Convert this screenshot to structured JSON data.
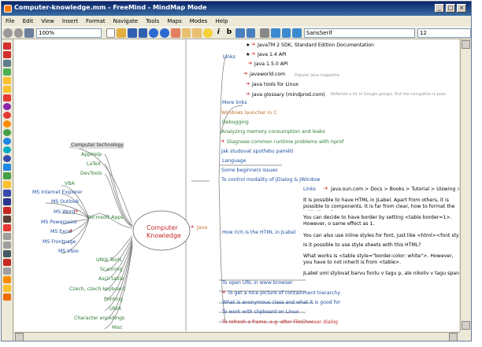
{
  "window": {
    "title": "Computer-knowledge.mm - FreeMind - MindMap Mode"
  },
  "menu": [
    "File",
    "Edit",
    "View",
    "Insert",
    "Format",
    "Navigate",
    "Tools",
    "Maps",
    "Modes",
    "Help"
  ],
  "toolbar": {
    "zoom": "100%",
    "font": "SansSerif",
    "size": "12"
  },
  "root": "Computer Knowledge",
  "left": {
    "computer_technology": "Computer technology",
    "apphelp": "AppHelp",
    "latex": "LaTeX",
    "devtools": "DevTools",
    "vba": "VBA",
    "ms_ie": "MS Internet Explorer",
    "ms_outlook": "MS Outlook",
    "ms_word": "MS Word",
    "ms_powerpoint": "MS Powerpoint",
    "ms_excel": "MS Excel",
    "ms_frontpage": "MS Frontpage",
    "ms_visio": "MS Visio",
    "microsoft_apps": "Microsoft Apps",
    "unix_tools": "UNIX Tools",
    "scanning": "Scanning",
    "ascii_table": "Ascii table",
    "czech_keyboard": "Czech, czech keyboard",
    "printing": "Printing",
    "unix": "UNIX",
    "character_encodings": "Character encodings",
    "misc": "Misc"
  },
  "java": "Java",
  "links": "Links",
  "java_links": [
    {
      "text": "JavaTM 2 SDK, Standard Edition  Documentation",
      "note": ""
    },
    {
      "text": "Java 1.4 API",
      "note": ""
    },
    {
      "text": "Java 1.5.0 API",
      "note": ""
    },
    {
      "text": "javaworld.com",
      "note": "Popular Java magazine"
    },
    {
      "text": "Java tools for Linux",
      "note": ""
    },
    {
      "text": "Java glossary  (mindprod.com)",
      "note": "Referred a lot in Google groups. But the navigation is poor."
    }
  ],
  "java_items_top": [
    "More links",
    "Windows launcher in C",
    "Debugging",
    "Analyzing memory consumption and leaks",
    "Diagnose common runtime problems with hprof",
    "Jak studovat spotřebu paměti",
    "Language",
    "Some beginners issues",
    "To control modality of JDialog & JWindow"
  ],
  "html_label": {
    "title": "How rich is the HTML in JLabel",
    "links": "Links",
    "breadcrumb": "java.sun.com > Docs > Books > Tutorial > Uiswing > Comp",
    "p1": "It is possible to have HTML in JLabel. Apart from others, it is possible to components. It is far from clear, how to format the table though.",
    "p2": "You can decide to have border by setting <table border=1>. However, o same effect as 1.",
    "p3": "You can also use inline styles for font, just like <html><font style=\"color:",
    "p4": "Is it possible to use style sheets with this HTML?",
    "p5": "What works is <table style=\"border-color: white\">. However, you have to not inherit is from <table>.",
    "p6": "JLabel umí stylovat barvu fontu v tagu p, ale nikoliv v tagu span."
  },
  "java_items_bottom": [
    "To open URL in www browser",
    "To get a nice picture of containment hierarchy",
    "What is anonymous class and what it is good for",
    "To work with clipboard on Linux",
    "To refresh a frame, e.g. after FileChooser dialog"
  ]
}
